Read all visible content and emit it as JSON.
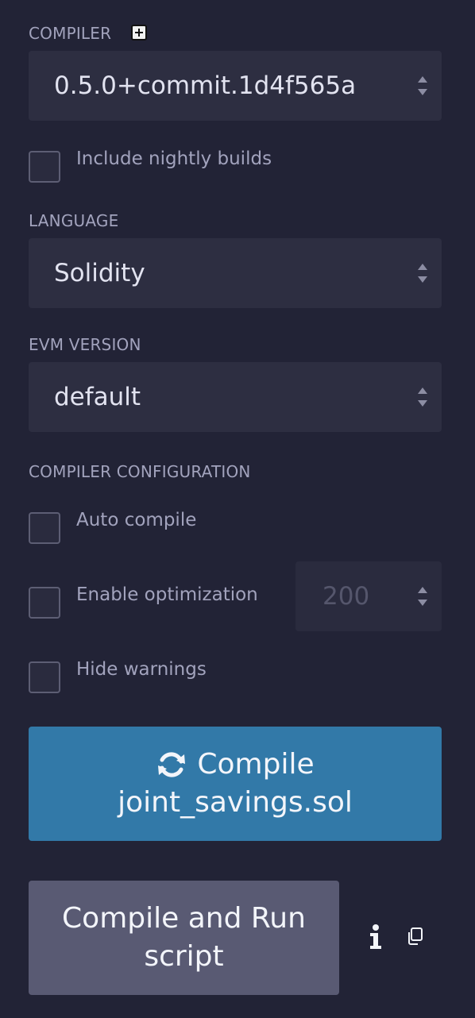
{
  "compiler": {
    "section_label": "COMPILER",
    "add_icon": "plus-square-icon",
    "version": "0.5.0+commit.1d4f565a",
    "nightly_label": "Include nightly builds"
  },
  "language": {
    "section_label": "LANGUAGE",
    "value": "Solidity"
  },
  "evm": {
    "section_label": "EVM VERSION",
    "value": "default"
  },
  "config": {
    "section_label": "COMPILER CONFIGURATION",
    "auto_compile_label": "Auto compile",
    "optimization_label": "Enable optimization",
    "optimization_runs": "200",
    "hide_warnings_label": "Hide warnings"
  },
  "actions": {
    "compile_line1": "Compile",
    "compile_line2": "joint_savings.sol",
    "compile_icon": "sync-icon",
    "run_line1": "Compile and Run",
    "run_line2": "script",
    "info_icon": "info-icon",
    "copy_icon": "copy-icon"
  },
  "colors": {
    "background": "#222336",
    "field": "#2d2e41",
    "primary_button": "#3279a8",
    "secondary_button": "#595a73"
  }
}
